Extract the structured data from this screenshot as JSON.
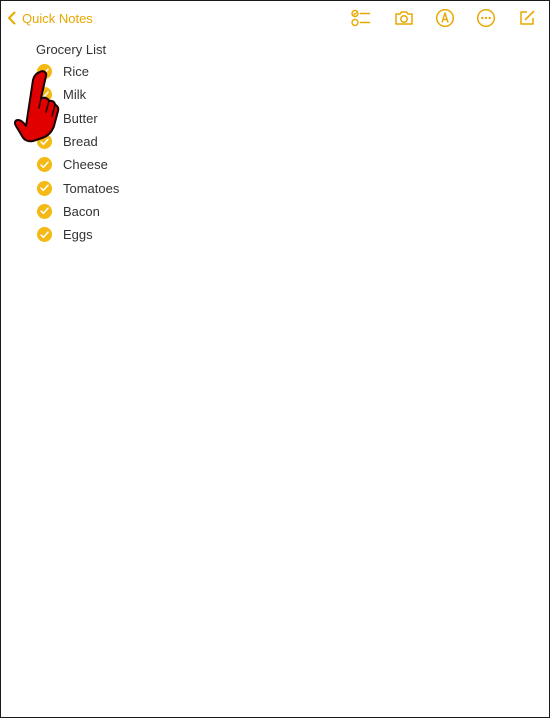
{
  "toolbar": {
    "back_label": "Quick Notes",
    "accent_color": "#e8a800",
    "icons": [
      "checklist-icon",
      "camera-icon",
      "markup-pen-icon",
      "more-icon",
      "compose-icon"
    ]
  },
  "note": {
    "title": "Grocery List",
    "items": [
      {
        "label": "Rice",
        "checked": true
      },
      {
        "label": "Milk",
        "checked": true
      },
      {
        "label": "Butter",
        "checked": true
      },
      {
        "label": "Bread",
        "checked": true
      },
      {
        "label": "Cheese",
        "checked": true
      },
      {
        "label": "Tomatoes",
        "checked": true
      },
      {
        "label": "Bacon",
        "checked": true
      },
      {
        "label": "Eggs",
        "checked": true
      }
    ]
  },
  "overlay": {
    "pointer_icon": "tap-hand-icon",
    "pointer_color": "#e00000"
  }
}
